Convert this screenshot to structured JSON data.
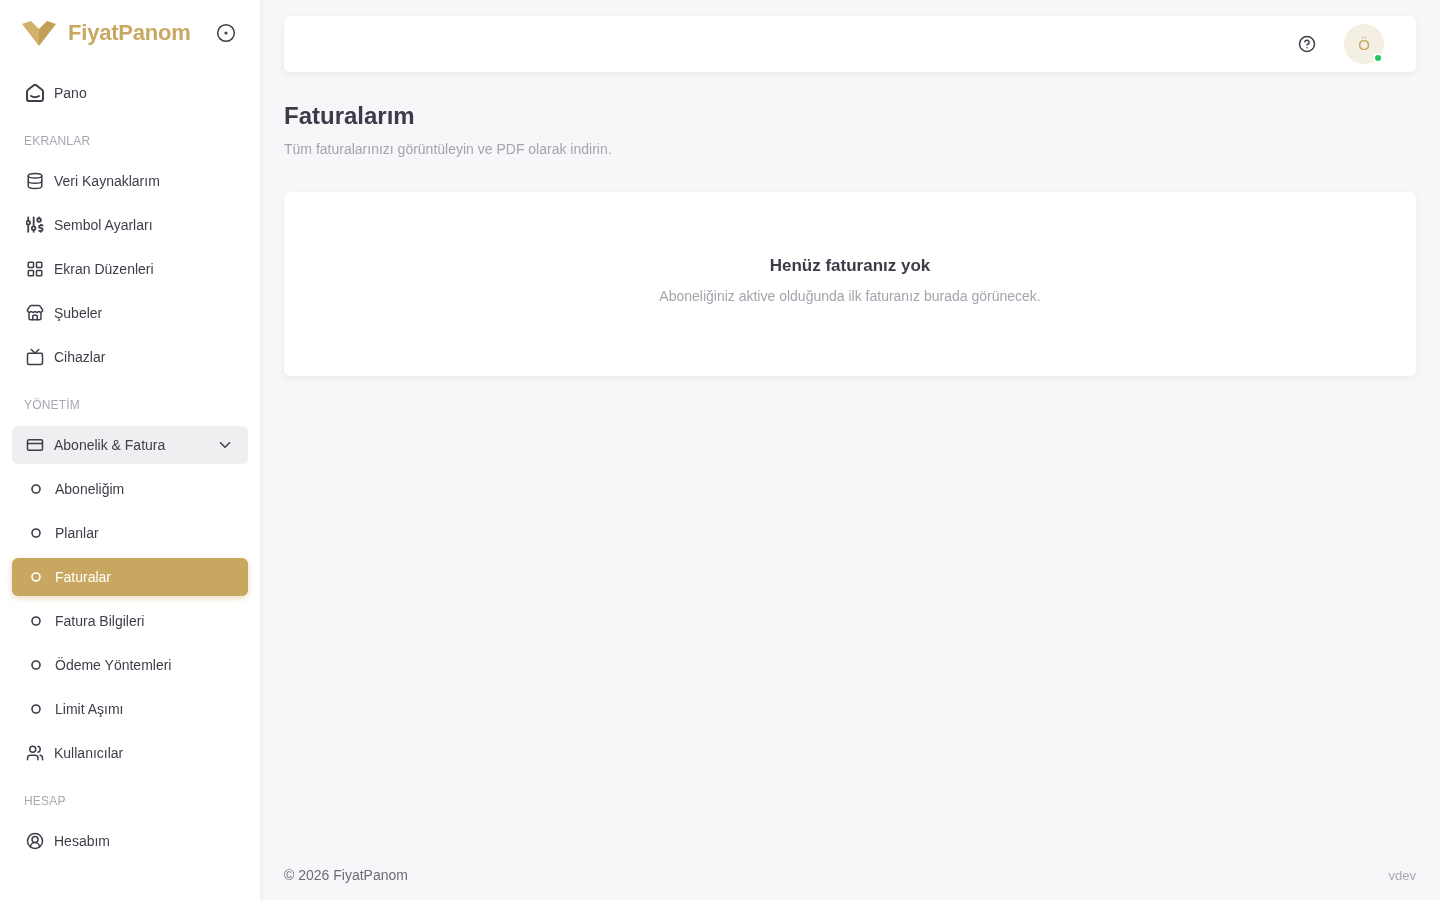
{
  "brand": {
    "name": "FiyatPanom"
  },
  "sidebar": {
    "items": [
      {
        "kind": "link",
        "label": "Pano",
        "selected": false
      },
      {
        "kind": "section",
        "label": "EKRANLAR"
      },
      {
        "kind": "link",
        "label": "Veri Kaynaklarım",
        "selected": false
      },
      {
        "kind": "link",
        "label": "Sembol Ayarları",
        "selected": false
      },
      {
        "kind": "link",
        "label": "Ekran Düzenleri",
        "selected": false
      },
      {
        "kind": "link",
        "label": "Şubeler",
        "selected": false
      },
      {
        "kind": "link",
        "label": "Cihazlar",
        "selected": false
      },
      {
        "kind": "section",
        "label": "YÖNETİM"
      },
      {
        "kind": "group",
        "label": "Abonelik & Fatura",
        "selected": false,
        "expanded": true,
        "children": [
          {
            "label": "Aboneliğim",
            "selected": false
          },
          {
            "label": "Planlar",
            "selected": false
          },
          {
            "label": "Faturalar",
            "selected": true
          },
          {
            "label": "Fatura Bilgileri",
            "selected": false
          },
          {
            "label": "Ödeme Yöntemleri",
            "selected": false
          },
          {
            "label": "Limit Aşımı",
            "selected": false
          }
        ]
      },
      {
        "kind": "link",
        "label": "Kullanıcılar",
        "selected": false
      },
      {
        "kind": "section",
        "label": "HESAP"
      },
      {
        "kind": "link",
        "label": "Hesabım",
        "selected": false
      }
    ]
  },
  "topbar": {
    "user": {
      "initial": "Ö",
      "online": true
    }
  },
  "page": {
    "title": "Faturalarım",
    "subtitle": "Tüm faturalarınızı görüntüleyin ve PDF olarak indirin."
  },
  "empty_state": {
    "title": "Henüz faturanız yok",
    "text": "Aboneliğiniz aktive olduğunda ilk faturanız burada görünecek."
  },
  "footer": {
    "copyright": "© 2026 FiyatPanom",
    "version": "vdev"
  }
}
